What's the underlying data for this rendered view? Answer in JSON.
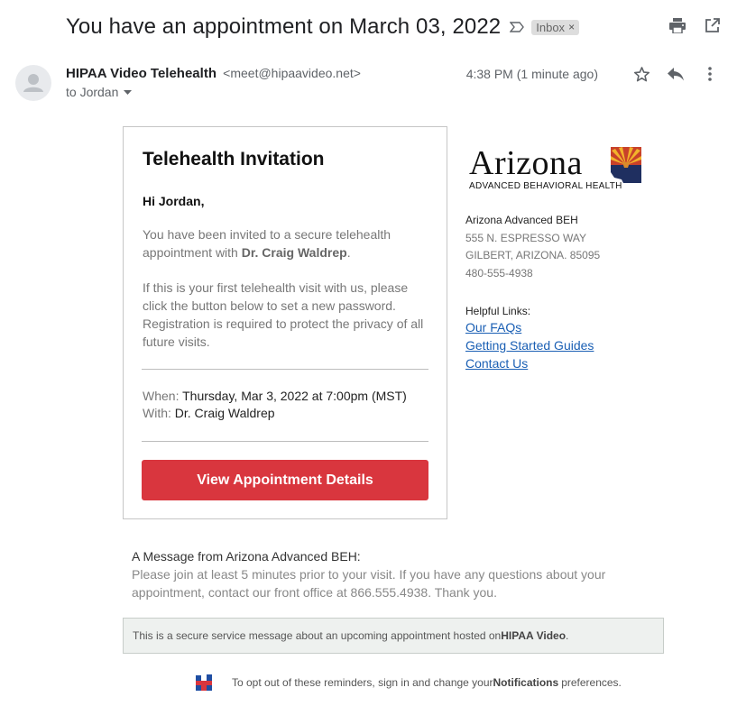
{
  "email": {
    "subject": "You have an appointment on March 03, 2022",
    "label": "Inbox",
    "label_close": "×",
    "sender_name": "HIPAA Video Telehealth",
    "sender_email": "<meet@hipaavideo.net>",
    "to": "to Jordan",
    "timestamp": "4:38 PM (1 minute ago)"
  },
  "icons": {
    "important": "important-marker-icon",
    "print": "print-icon",
    "open_new_window": "open-in-new-window-icon",
    "star": "star-icon",
    "reply": "reply-icon",
    "more": "more-vert-icon",
    "avatar": "person-avatar-icon",
    "dropdown": "chevron-down-icon"
  },
  "card": {
    "title": "Telehealth Invitation",
    "greeting": "Hi Jordan,",
    "p1_before": "You have been invited to a secure telehealth appointment with ",
    "p1_doctor": "Dr. Craig Waldrep",
    "p1_after": ".",
    "p2": "If this is your first telehealth visit with us, please click the button below to set a new password. Registration is required to protect the privacy of all future visits.",
    "when_label": "When: ",
    "when_value": "Thursday, Mar 3, 2022 at 7:00pm (MST)",
    "with_label": "With: ",
    "with_value": "Dr. Craig Waldrep",
    "button": "View Appointment Details"
  },
  "sidebar": {
    "logo_word": "Arizona",
    "logo_sub": "ADVANCED BEHAVIORAL HEALTH",
    "org_name": "Arizona Advanced BEH",
    "address1": "555 N. ESPRESSO WAY",
    "address2": "GILBERT, ARIZONA. 85095",
    "phone": "480-555-4938",
    "links_heading": "Helpful Links:",
    "links": [
      "Our FAQs",
      "Getting Started Guides",
      "Contact Us"
    ]
  },
  "message": {
    "heading": "A Message from Arizona Advanced BEH:",
    "body": "Please join at least 5 minutes prior to your visit. If you have any questions about your appointment, contact our front office at 866.555.4938. Thank you."
  },
  "notice": {
    "before": "This is a secure service message about an upcoming appointment hosted on ",
    "brand": "HIPAA Video",
    "after": "."
  },
  "footer": {
    "before": "To opt out of these reminders, sign in and change your ",
    "bold": "Notifications",
    "after": " preferences."
  },
  "colors": {
    "cta": "#d9363e",
    "link": "#1a5fb4",
    "notice_bg": "#eef1ef"
  }
}
